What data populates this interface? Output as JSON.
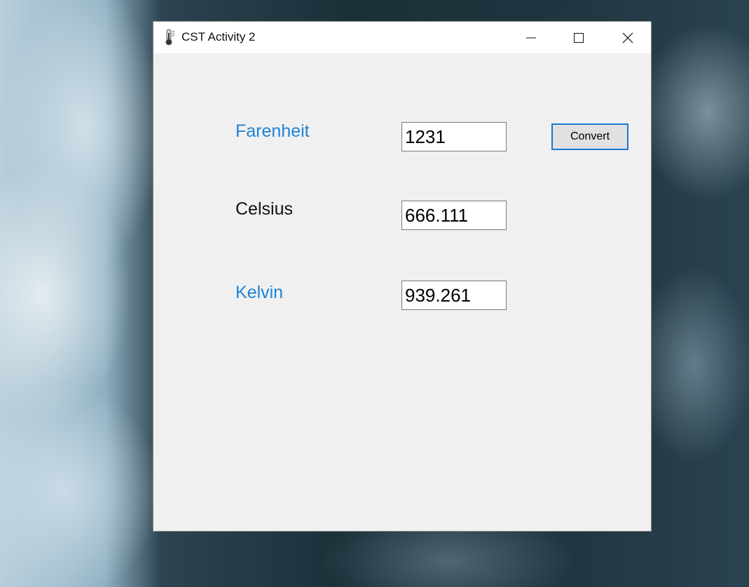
{
  "window": {
    "title": "CST Activity 2",
    "icon": "thermometer-icon",
    "controls": {
      "minimize_icon": "minimize-icon",
      "maximize_icon": "maximize-icon",
      "close_icon": "close-icon"
    }
  },
  "form": {
    "fahrenheit": {
      "label": "Farenheit",
      "value": "1231"
    },
    "celsius": {
      "label": "Celsius",
      "value": "666.111"
    },
    "kelvin": {
      "label": "Kelvin",
      "value": "939.261"
    },
    "convert_label": "Convert"
  },
  "colors": {
    "label_blue": "#1e84d6",
    "label_black": "#111111",
    "button_focus_border": "#1a78d4",
    "client_background": "#f0f0f0"
  }
}
